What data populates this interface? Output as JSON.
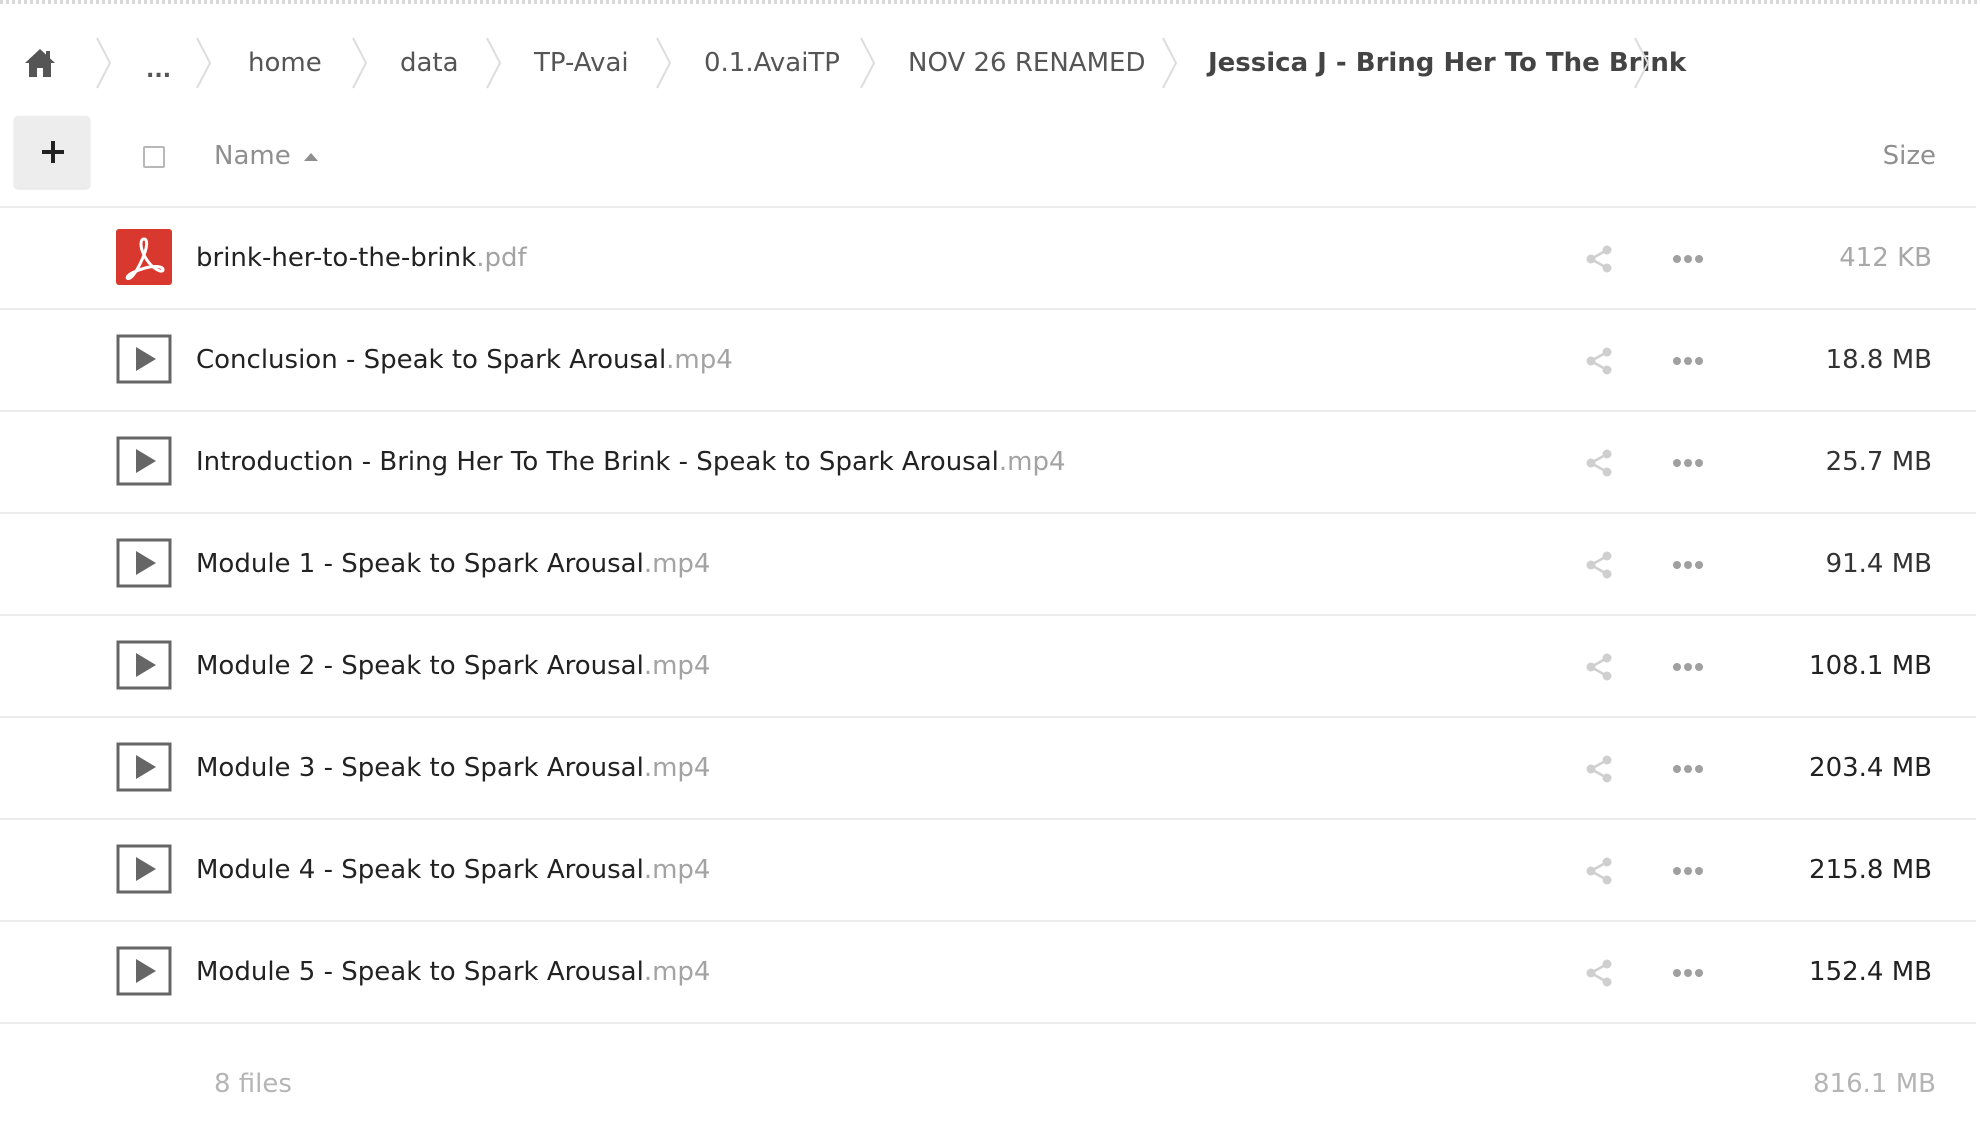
{
  "breadcrumb": {
    "home_icon": "home-icon",
    "ellipsis": "...",
    "items": [
      {
        "label": "home"
      },
      {
        "label": "data"
      },
      {
        "label": "TP-Avai"
      },
      {
        "label": "0.1.AvaiTP"
      },
      {
        "label": "NOV 26 RENAMED"
      },
      {
        "label": "Jessica J - Bring Her To The Brink"
      }
    ]
  },
  "header": {
    "add_icon": "plus-icon",
    "name_label": "Name",
    "size_label": "Size"
  },
  "files": [
    {
      "basename": "brink-her-to-the-brink",
      "ext": ".pdf",
      "size": "412 KB",
      "icon": "pdf-icon",
      "size_color": "#a8a8a8"
    },
    {
      "basename": "Conclusion - Speak to Spark Arousal",
      "ext": ".mp4",
      "size": "18.8 MB",
      "icon": "video-icon",
      "size_color": "#333333"
    },
    {
      "basename": "Introduction - Bring Her To The Brink - Speak to Spark Arousal",
      "ext": ".mp4",
      "size": "25.7 MB",
      "icon": "video-icon",
      "size_color": "#333333"
    },
    {
      "basename": "Module 1 - Speak to Spark Arousal",
      "ext": ".mp4",
      "size": "91.4 MB",
      "icon": "video-icon",
      "size_color": "#333333"
    },
    {
      "basename": "Module 2 - Speak to Spark Arousal",
      "ext": ".mp4",
      "size": "108.1 MB",
      "icon": "video-icon",
      "size_color": "#222222"
    },
    {
      "basename": "Module 3 - Speak to Spark Arousal",
      "ext": ".mp4",
      "size": "203.4 MB",
      "icon": "video-icon",
      "size_color": "#222222"
    },
    {
      "basename": "Module 4 - Speak to Spark Arousal",
      "ext": ".mp4",
      "size": "215.8 MB",
      "icon": "video-icon",
      "size_color": "#222222"
    },
    {
      "basename": "Module 5 - Speak to Spark Arousal",
      "ext": ".mp4",
      "size": "152.4 MB",
      "icon": "video-icon",
      "size_color": "#222222"
    }
  ],
  "summary": {
    "count": "8 files",
    "total_size": "816.1 MB"
  },
  "colors": {
    "pdf_red": "#d9382f",
    "icon_gray": "#bdbdbd",
    "video_icon": "#666666"
  }
}
